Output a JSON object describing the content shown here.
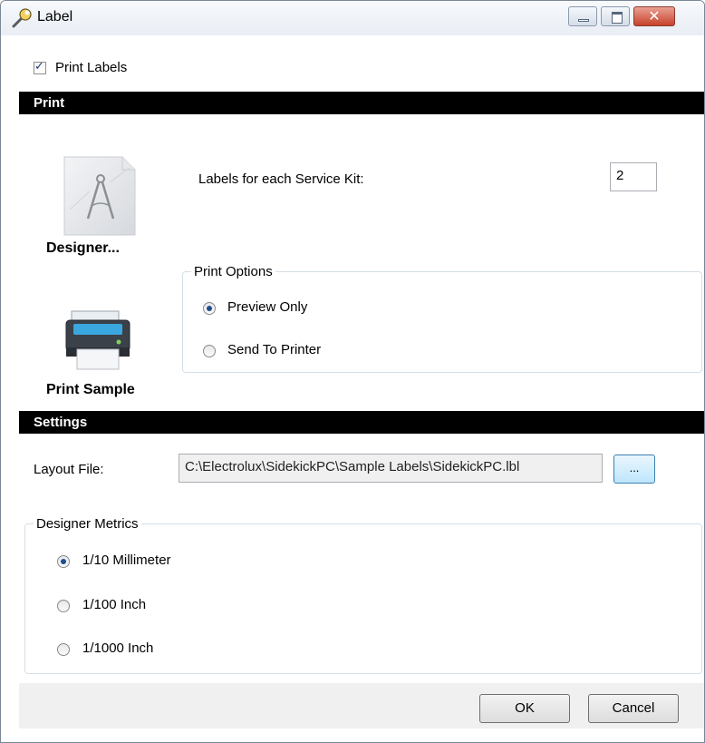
{
  "window": {
    "title": "Label",
    "icon": "wrench-icon",
    "controls": {
      "minimize": "minimize-icon",
      "maximize": "maximize-icon",
      "close": "✕"
    }
  },
  "print_labels": {
    "label": "Print Labels",
    "checked": true
  },
  "sections": {
    "print": "Print",
    "settings": "Settings"
  },
  "designer": {
    "label": "Designer...",
    "icon": "compass-document-icon"
  },
  "print_sample": {
    "label": "Print Sample",
    "icon": "printer-icon"
  },
  "labels_per_kit": {
    "label": "Labels for each Service Kit:",
    "value": "2"
  },
  "print_options": {
    "title": "Print Options",
    "options": [
      {
        "label": "Preview Only",
        "selected": true
      },
      {
        "label": "Send To Printer",
        "selected": false
      }
    ]
  },
  "layout_file": {
    "label": "Layout File:",
    "value": "C:\\Electrolux\\SidekickPC\\Sample Labels\\SidekickPC.lbl",
    "browse_label": "..."
  },
  "designer_metrics": {
    "title": "Designer Metrics",
    "options": [
      {
        "label": "1/10 Millimeter",
        "selected": true
      },
      {
        "label": "1/100 Inch",
        "selected": false
      },
      {
        "label": "1/1000 Inch",
        "selected": false
      }
    ]
  },
  "buttons": {
    "ok": "OK",
    "cancel": "Cancel"
  },
  "colors": {
    "section_bar": "#000000",
    "radio_dot": "#1f4e8c",
    "close_button": "#c7412b"
  }
}
